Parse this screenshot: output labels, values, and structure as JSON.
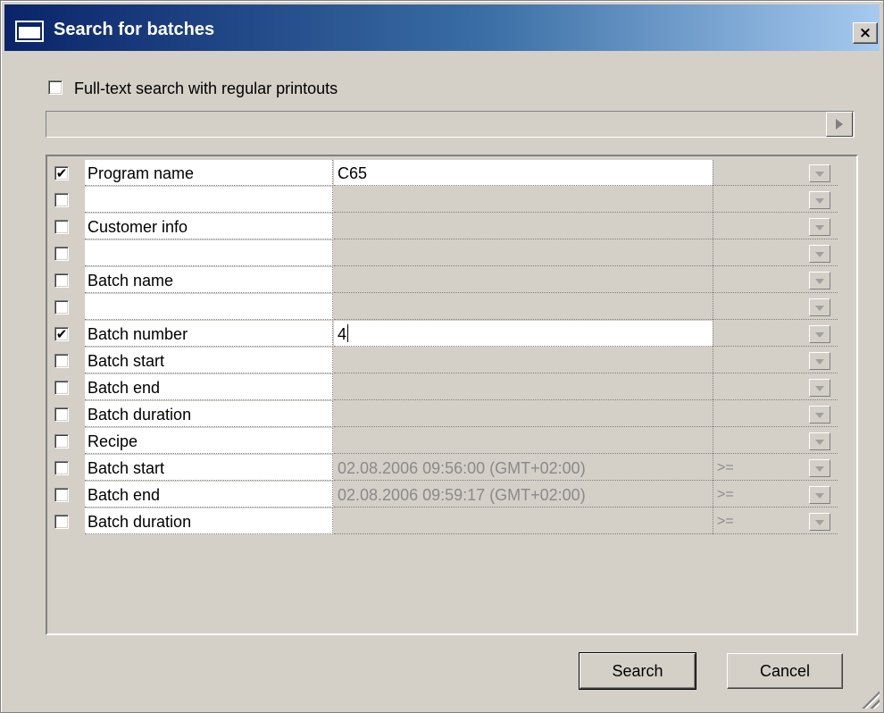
{
  "window": {
    "title": "Search for batches",
    "close_label": "×"
  },
  "fulltext": {
    "label": "Full-text search with regular printouts",
    "checked": false,
    "value": ""
  },
  "rows": [
    {
      "checked": true,
      "name": "Program name",
      "value": "C65",
      "operator": "",
      "active": true
    },
    {
      "checked": false,
      "name": "",
      "value": "",
      "operator": "",
      "active": false
    },
    {
      "checked": false,
      "name": "Customer info",
      "value": "",
      "operator": "",
      "active": false
    },
    {
      "checked": false,
      "name": "",
      "value": "",
      "operator": "",
      "active": false
    },
    {
      "checked": false,
      "name": "Batch name",
      "value": "",
      "operator": "",
      "active": false
    },
    {
      "checked": false,
      "name": "",
      "value": "",
      "operator": "",
      "active": false
    },
    {
      "checked": true,
      "name": "Batch number",
      "value": "4",
      "operator": "",
      "active": true
    },
    {
      "checked": false,
      "name": "Batch start",
      "value": "",
      "operator": "",
      "active": false
    },
    {
      "checked": false,
      "name": "Batch end",
      "value": "",
      "operator": "",
      "active": false
    },
    {
      "checked": false,
      "name": "Batch duration",
      "value": "",
      "operator": "",
      "active": false
    },
    {
      "checked": false,
      "name": "Recipe",
      "value": "",
      "operator": "",
      "active": false
    },
    {
      "checked": false,
      "name": "Batch start",
      "value": "02.08.2006 09:56:00 (GMT+02:00)",
      "operator": ">=",
      "active": false
    },
    {
      "checked": false,
      "name": "Batch end",
      "value": "02.08.2006 09:59:17 (GMT+02:00)",
      "operator": ">=",
      "active": false
    },
    {
      "checked": false,
      "name": "Batch duration",
      "value": "",
      "operator": ">=",
      "active": false
    }
  ],
  "buttons": {
    "search": "Search",
    "cancel": "Cancel"
  },
  "colors": {
    "title_start": "#0a246a",
    "title_end": "#a6caf0",
    "face": "#d4d0c8"
  },
  "icons": {
    "check": "✔",
    "window_icon": "window-icon",
    "close": "close-icon"
  }
}
